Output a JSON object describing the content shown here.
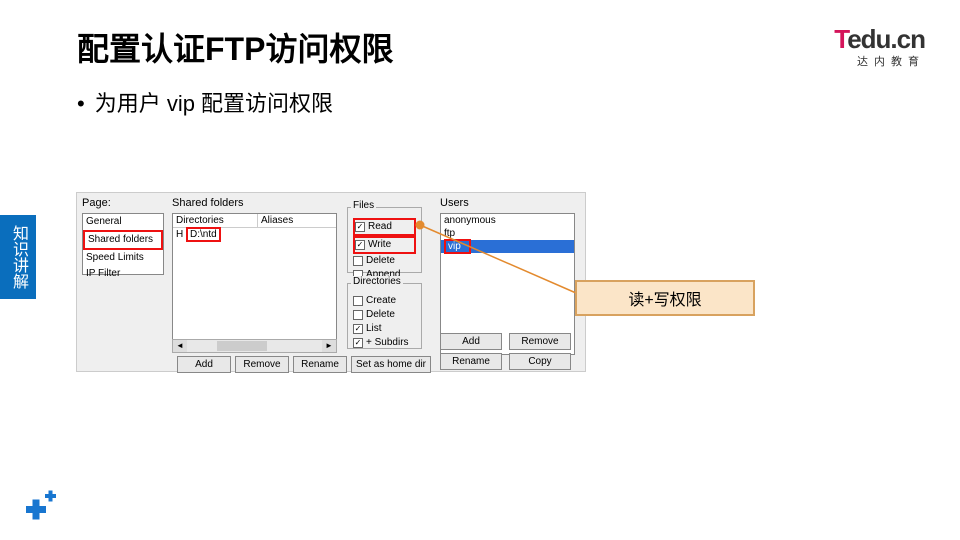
{
  "title": "配置认证FTP访问权限",
  "bullet": "为用户 vip 配置访问权限",
  "logo": {
    "brand_t": "T",
    "brand_rest": "edu.cn",
    "sub": "达内教育"
  },
  "side_tab": "知识讲解",
  "annotation": "读+写权限",
  "dialog": {
    "page_label": "Page:",
    "page_items": [
      "General",
      "Shared folders",
      "Speed Limits",
      "IP Filter"
    ],
    "shared_folders_label": "Shared folders",
    "col_dir": "Directories",
    "col_alias": "Aliases",
    "folder_row_prefix": "H",
    "folder_row_path": "D:\\ntd",
    "files_label": "Files",
    "files_opts": {
      "read": "Read",
      "write": "Write",
      "delete": "Delete",
      "append": "Append"
    },
    "dirs_label": "Directories",
    "dirs_opts": {
      "create": "Create",
      "delete": "Delete",
      "list": "List",
      "subdirs": "+ Subdirs"
    },
    "users_label": "Users",
    "users": [
      "anonymous",
      "ftp",
      "vip"
    ],
    "buttons": {
      "add": "Add",
      "remove": "Remove",
      "rename": "Rename",
      "set_home": "Set as home dir",
      "users_add": "Add",
      "users_remove": "Remove",
      "users_rename": "Rename",
      "users_copy": "Copy"
    }
  }
}
